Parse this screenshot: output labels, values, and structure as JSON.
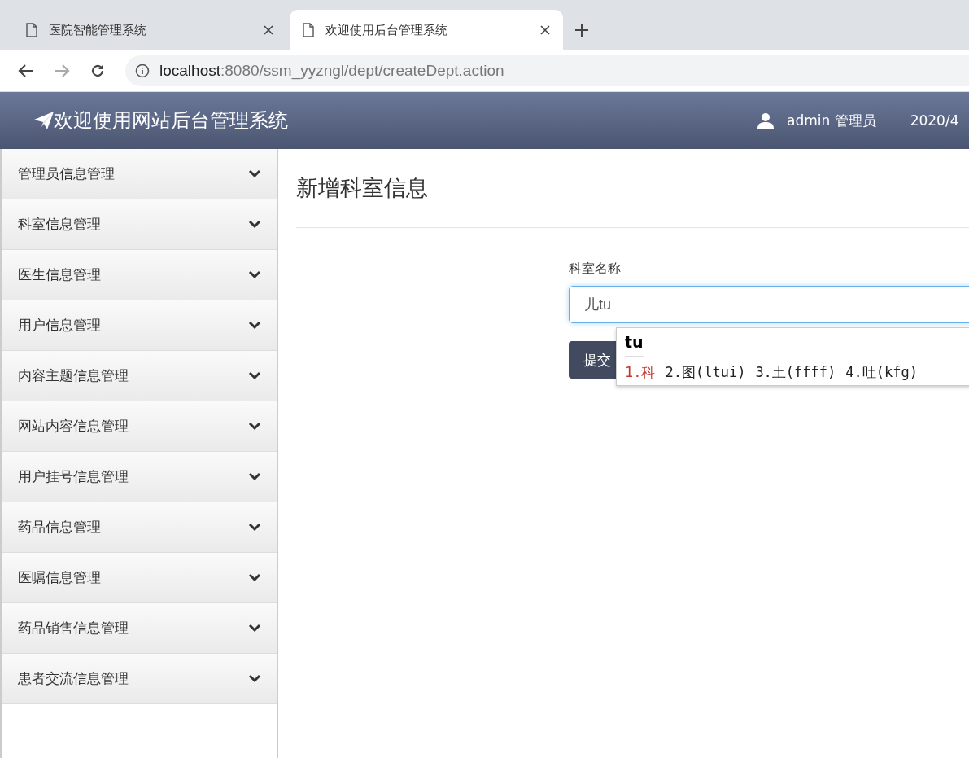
{
  "browser": {
    "tabs": [
      {
        "title": "医院智能管理系统",
        "selected": false
      },
      {
        "title": "欢迎使用后台管理系统",
        "selected": true
      }
    ],
    "url_host": "localhost",
    "url_rest": ":8080/ssm_yyzngl/dept/createDept.action"
  },
  "header": {
    "title": "欢迎使用网站后台管理系统",
    "user": "admin 管理员",
    "date": "2020/4"
  },
  "sidebar": {
    "items": [
      {
        "label": "管理员信息管理",
        "expanded": false
      },
      {
        "label": "科室信息管理",
        "expanded": false
      },
      {
        "label": "医生信息管理",
        "expanded": false
      },
      {
        "label": "用户信息管理",
        "expanded": false
      },
      {
        "label": "内容主题信息管理",
        "expanded": false
      },
      {
        "label": "网站内容信息管理",
        "expanded": false
      },
      {
        "label": "用户挂号信息管理",
        "expanded": false
      },
      {
        "label": "药品信息管理",
        "expanded": false
      },
      {
        "label": "医嘱信息管理",
        "expanded": false
      },
      {
        "label": "药品销售信息管理",
        "expanded": false
      },
      {
        "label": "患者交流信息管理",
        "expanded": false
      }
    ]
  },
  "page": {
    "title": "新增科室信息",
    "field_label": "科室名称",
    "field_value": "儿tu",
    "submit": "提交"
  },
  "ime": {
    "composition": "tu",
    "candidates": [
      {
        "text": "1.科",
        "selected": true
      },
      {
        "text": "2.图(ltui)",
        "selected": false
      },
      {
        "text": "3.土(ffff)",
        "selected": false
      },
      {
        "text": "4.吐(kfg)",
        "selected": false
      }
    ]
  }
}
